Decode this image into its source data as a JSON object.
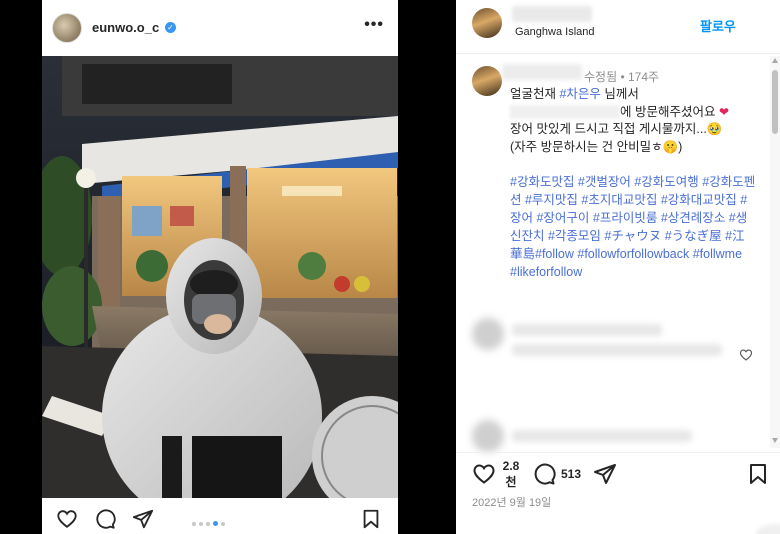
{
  "left_post": {
    "username": "eunwo.o_c",
    "verified_badge": "✓",
    "more_label": "•••",
    "carousel": {
      "count": 5,
      "active_index": 3
    },
    "icons": [
      "heart-icon",
      "comment-icon",
      "share-icon",
      "bookmark-icon"
    ]
  },
  "right_post": {
    "header": {
      "location": "Ganghwa Island",
      "follow_label": "팔로우"
    },
    "caption": {
      "meta": "수정됨 • 174주",
      "line1_prefix": "얼굴천재 ",
      "line1_tag": "#차은우",
      "line1_suffix": " 님께서",
      "line2_suffix": "에 방문해주셨어요",
      "line2_emoji": "❤",
      "line3": "장어 맛있게 드시고 직접 게시물까지...",
      "line3_emoji": "🥹",
      "line4": "(자주 방문하시는 건 안비밀ㅎ",
      "line4_emoji": "🤫",
      "line4_end": ")",
      "hashtags": "#강화도맛집 #갯벌장어 #강화도여행 #강화도펜션 #루지맛집 #초지대교맛집 #강화대교맛집 #장어 #장어구이 #프라이빗룸 #상견례장소 #생신잔치 #각종모임 #チャウヌ #うなぎ屋 #江華島#follow #followforfollowback #follwme #likeforfollow"
    },
    "actions": {
      "likes_count": "2.8\n천",
      "likes_line1": "2.8",
      "likes_line2": "천",
      "comment_count": "513",
      "date": "2022년 9월 19일"
    },
    "accent_color": "#0095f6",
    "hashtag_color": "#4a6fd6"
  }
}
